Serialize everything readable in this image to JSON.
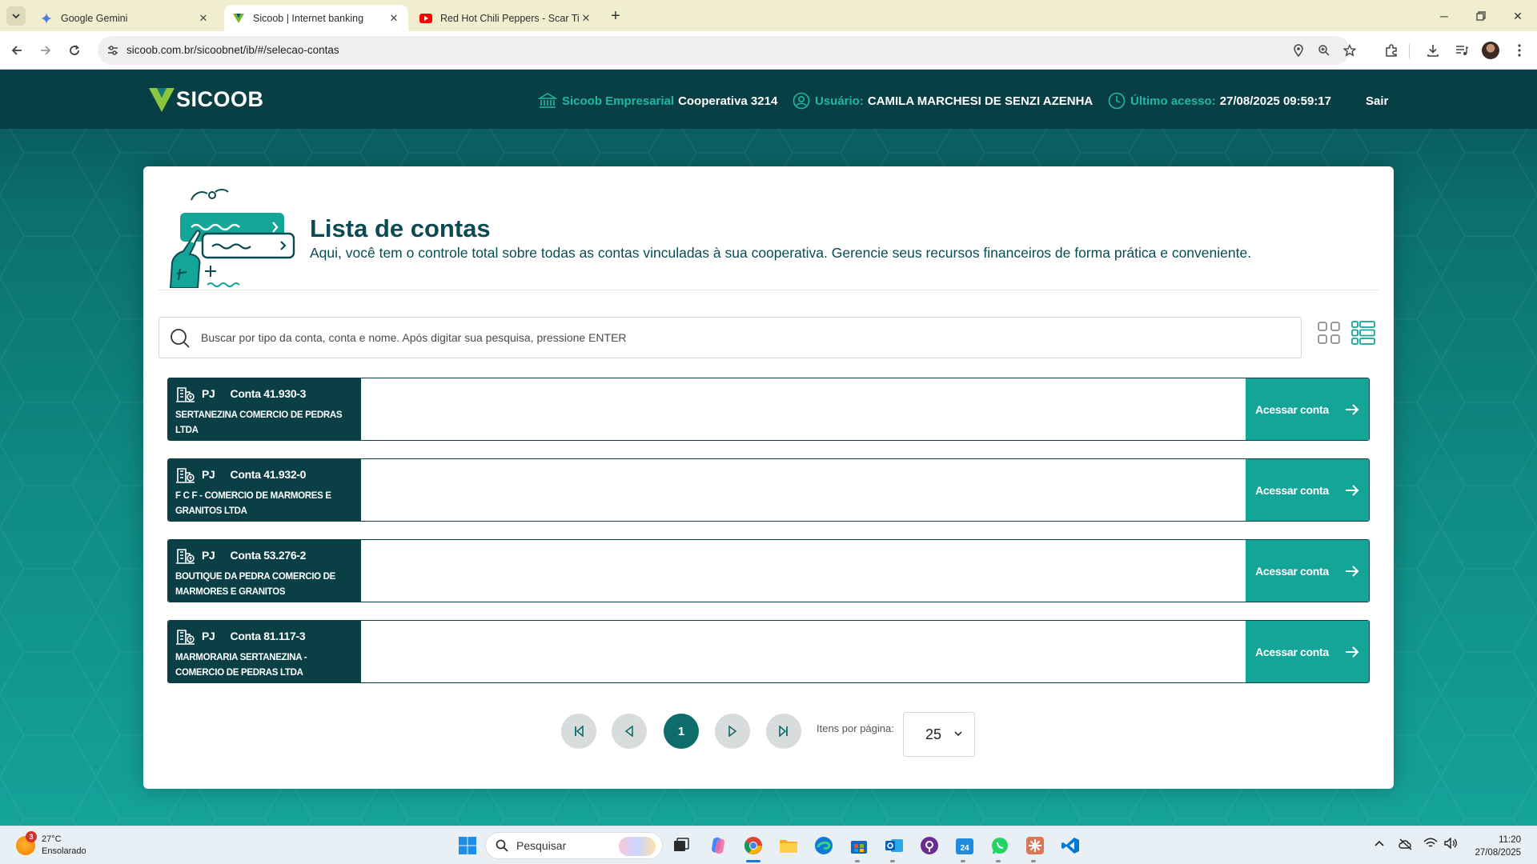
{
  "browser": {
    "tabs": [
      {
        "title": "Google Gemini",
        "icon": "gemini-icon",
        "active": false
      },
      {
        "title": "Sicoob | Internet banking",
        "icon": "sicoob-favicon",
        "active": true
      },
      {
        "title": "Red Hot Chili Peppers - Scar Tis",
        "icon": "youtube-icon",
        "active": false
      }
    ],
    "url": "sicoob.com.br/sicoobnet/ib/#/selecao-contas"
  },
  "header": {
    "logo": "SICOOB",
    "cooperative_label": "Sicoob Empresarial",
    "cooperative_value": "Cooperativa 3214",
    "user_label": "Usuário:",
    "user_value": "CAMILA MARCHESI DE SENZI AZENHA",
    "last_access_label": "Último acesso:",
    "last_access_value": "27/08/2025 09:59:17",
    "logout": "Sair"
  },
  "main": {
    "title": "Lista de contas",
    "subtitle": "Aqui, você tem o controle total sobre todas as contas vinculadas à sua cooperativa. Gerencie seus recursos financeiros de forma prática e conveniente.",
    "search_placeholder": "Buscar por tipo da conta, conta e nome. Após digitar sua pesquisa, pressione ENTER",
    "accounts": [
      {
        "type": "PJ",
        "number": "Conta 41.930-3",
        "name": "SERTANEZINA COMERCIO DE PEDRAS LTDA",
        "action": "Acessar conta"
      },
      {
        "type": "PJ",
        "number": "Conta 41.932-0",
        "name": "F C F - COMERCIO DE MARMORES E GRANITOS LTDA",
        "action": "Acessar conta"
      },
      {
        "type": "PJ",
        "number": "Conta 53.276-2",
        "name": "BOUTIQUE DA PEDRA COMERCIO DE MARMORES E GRANITOS",
        "action": "Acessar conta"
      },
      {
        "type": "PJ",
        "number": "Conta 81.117-3",
        "name": "MARMORARIA SERTANEZINA - COMERCIO DE PEDRAS LTDA",
        "action": "Acessar conta"
      }
    ],
    "pagination": {
      "current_page": "1",
      "items_per_page_label": "Itens por página:",
      "items_per_page": "25"
    }
  },
  "colors": {
    "brand_dark": "#0a3f45",
    "brand_accent": "#13a597",
    "header_bg": "#073f45"
  },
  "taskbar": {
    "weather_temp": "27°C",
    "weather_desc": "Ensolarado",
    "weather_badge": "3",
    "search_label": "Pesquisar",
    "time": "11:20",
    "date": "27/08/2025"
  }
}
